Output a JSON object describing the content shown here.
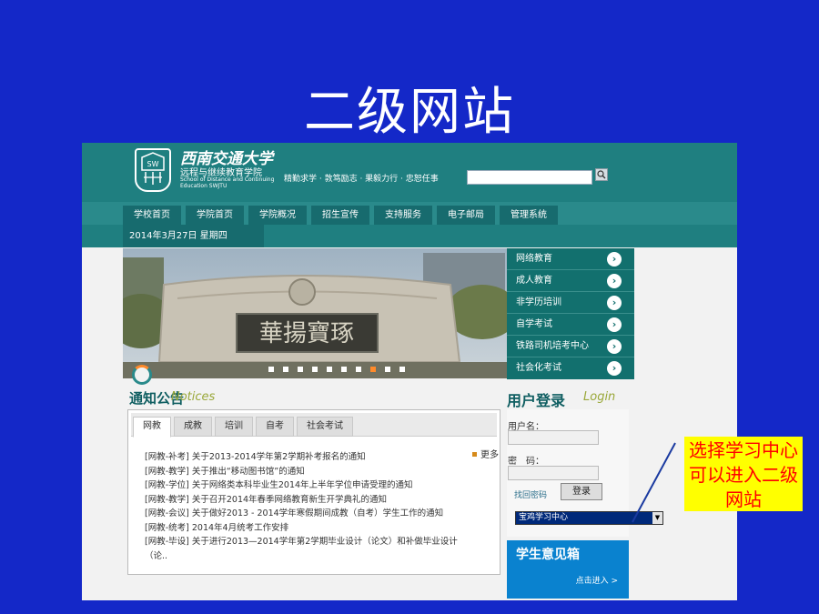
{
  "slide": {
    "title": "二级网站"
  },
  "header": {
    "school_cn": "西南交通大学",
    "college_cn": "远程与继续教育学院",
    "college_en": "School of Distance and Continuing Education SWJTU",
    "motto": "精勤求学 · 敦笃励志 · 果毅力行 · 忠恕任事"
  },
  "nav": {
    "items": [
      "学校首页",
      "学院首页",
      "学院概况",
      "招生宣传",
      "支持服务",
      "电子邮局",
      "管理系统"
    ]
  },
  "date": "2014年3月27日 星期四",
  "banner": {
    "inscription": "華揚寶琢"
  },
  "right_menu": [
    "网络教育",
    "成人教育",
    "非学历培训",
    "自学考试",
    "铁路司机培考中心",
    "社会化考试"
  ],
  "notices": {
    "title": "通知公告",
    "title_en": "Notices",
    "tabs": [
      "网教",
      "成教",
      "培训",
      "自考",
      "社会考试"
    ],
    "more": "更多",
    "items": [
      "[网教-补考] 关于2013-2014学年第2学期补考报名的通知",
      "[网教-教学] 关于推出“移动图书馆”的通知",
      "[网教-学位] 关于网络类本科毕业生2014年上半年学位申请受理的通知",
      "[网教-教学] 关于召开2014年春季网络教育新生开学典礼的通知",
      "[网教-会议] 关于做好2013 - 2014学年寒假期间成教（自考）学生工作的通知",
      "[网教-统考] 2014年4月统考工作安排",
      "[网教-毕设] 关于进行2013—2014学年第2学期毕业设计（论文）和补做毕业设计",
      "（论.."
    ]
  },
  "login": {
    "title": "用户登录",
    "title_en": "Login",
    "username_label": "用户名：",
    "password_label": "密　码：",
    "forgot": "找回密码",
    "submit": "登录",
    "site_select": "宝鸡学习中心"
  },
  "feedback": {
    "title": "学生意见箱",
    "enter": "点击进入 >"
  },
  "callout": {
    "text": "选择学习中心可以进入二级网站"
  },
  "colors": {
    "background": "#1428c8",
    "header": "#1f7f80",
    "callout_bg": "#ffff00",
    "callout_text": "#ff0000"
  }
}
